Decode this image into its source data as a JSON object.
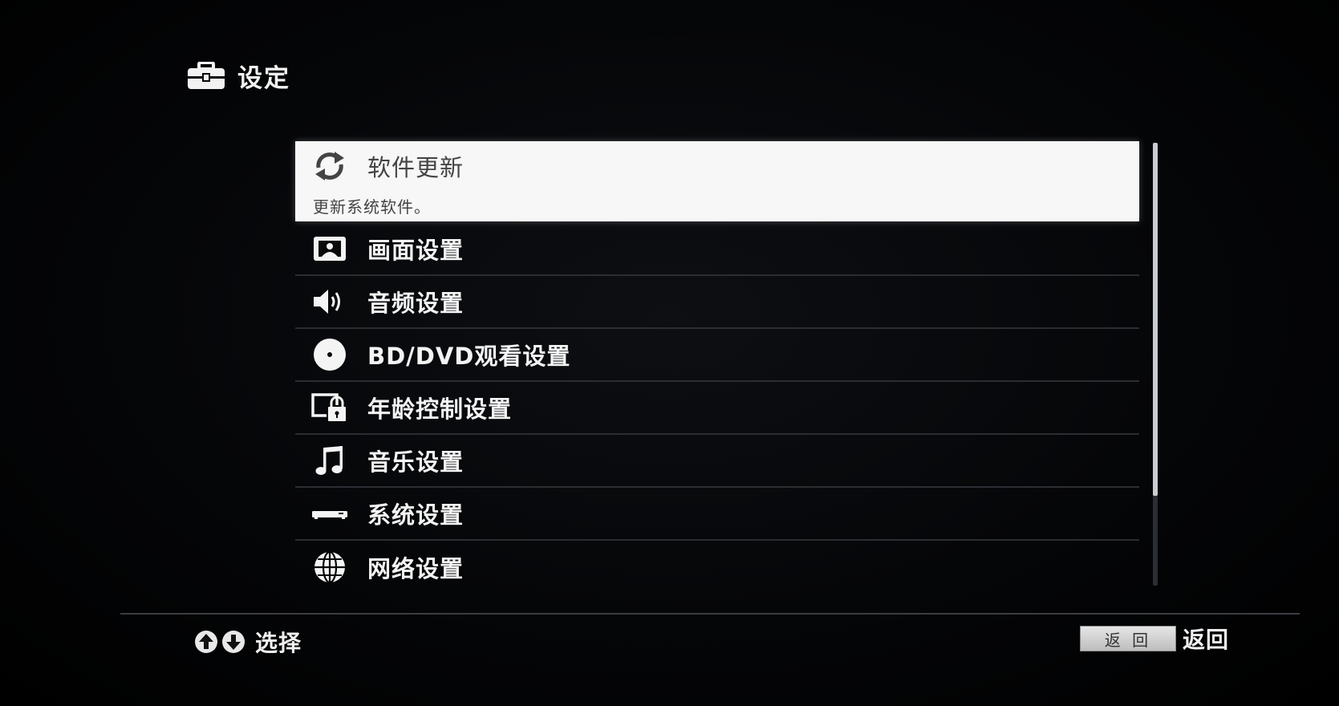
{
  "header": {
    "title": "设定",
    "icon": "toolbox-icon"
  },
  "menu": {
    "items": [
      {
        "label": "软件更新",
        "description": "更新系统软件。",
        "icon": "refresh-icon",
        "selected": true
      },
      {
        "label": "画面设置",
        "icon": "picture-icon"
      },
      {
        "label": "音频设置",
        "icon": "speaker-icon"
      },
      {
        "label": "BD/DVD观看设置",
        "icon": "disc-icon"
      },
      {
        "label": "年龄控制设置",
        "icon": "screen-lock-icon"
      },
      {
        "label": "音乐设置",
        "icon": "music-note-icon"
      },
      {
        "label": "系统设置",
        "icon": "player-device-icon"
      },
      {
        "label": "网络设置",
        "icon": "globe-icon"
      }
    ]
  },
  "footer": {
    "select_hint": "选择",
    "back_key_label": "返 回",
    "back_label": "返回"
  },
  "colors": {
    "background": "#000000",
    "highlight": "#f7f7f7",
    "text": "#f4f4f4",
    "divider": "#2a2d31"
  }
}
